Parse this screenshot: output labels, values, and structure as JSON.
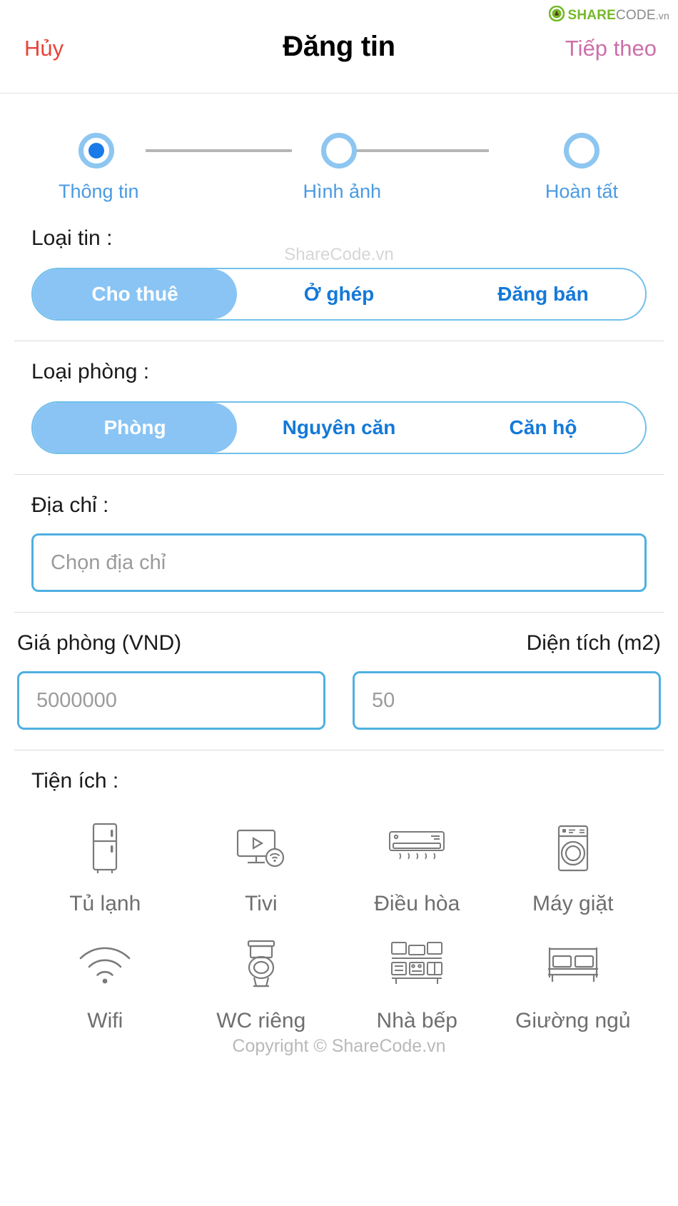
{
  "watermark": {
    "logo_share": "SHARE",
    "logo_code": "CODE",
    "logo_vn": ".vn",
    "mid_text": "ShareCode.vn",
    "copyright": "Copyright © ShareCode.vn"
  },
  "navbar": {
    "cancel_label": "Hủy",
    "title": "Đăng tin",
    "next_label": "Tiếp theo",
    "cancel_color": "#e8443a",
    "next_color": "#cc6fa8"
  },
  "stepper": {
    "active_index": 0,
    "accent_ring": "#8dc6f0",
    "accent_dot": "#1a7ae8",
    "label_color": "#4a9ae2",
    "steps": [
      {
        "label": "Thông tin"
      },
      {
        "label": "Hình ảnh"
      },
      {
        "label": "Hoàn tất"
      }
    ]
  },
  "post_type": {
    "label": "Loại tin :",
    "selected": "Cho thuê",
    "options": [
      {
        "label": "Cho thuê",
        "active": true
      },
      {
        "label": "Ở ghép",
        "active": false
      },
      {
        "label": "Đăng bán",
        "active": false
      }
    ]
  },
  "room_type": {
    "label": "Loại phòng :",
    "selected": "Phòng",
    "options": [
      {
        "label": "Phòng",
        "active": true
      },
      {
        "label": "Nguyên căn",
        "active": false
      },
      {
        "label": "Căn hộ",
        "active": false
      }
    ]
  },
  "address": {
    "label": "Địa chỉ :",
    "value": "",
    "placeholder": "Chọn địa chỉ"
  },
  "price": {
    "label": "Giá phòng (VND)",
    "value": "",
    "placeholder": "5000000"
  },
  "area": {
    "label": "Diện tích (m2)",
    "value": "",
    "placeholder": "50"
  },
  "amenities": {
    "label": "Tiện ích :",
    "items": [
      {
        "label": "Tủ lạnh",
        "icon": "fridge-icon"
      },
      {
        "label": "Tivi",
        "icon": "television-icon"
      },
      {
        "label": "Điều hòa",
        "icon": "air-conditioner-icon"
      },
      {
        "label": "Máy giặt",
        "icon": "washing-machine-icon"
      },
      {
        "label": "Wifi",
        "icon": "wifi-icon"
      },
      {
        "label": "WC riêng",
        "icon": "toilet-icon"
      },
      {
        "label": "Nhà bếp",
        "icon": "kitchen-icon"
      },
      {
        "label": "Giường ngủ",
        "icon": "bed-icon"
      }
    ]
  },
  "colors": {
    "segment_border": "#72c0ea",
    "segment_active_bg": "#89c4f4",
    "segment_text": "#1479d8",
    "input_border": "#4fb0e0",
    "placeholder": "#9b9b9b",
    "amenity_icon": "#7a7a7a",
    "amenity_label": "#6e6e6e"
  }
}
